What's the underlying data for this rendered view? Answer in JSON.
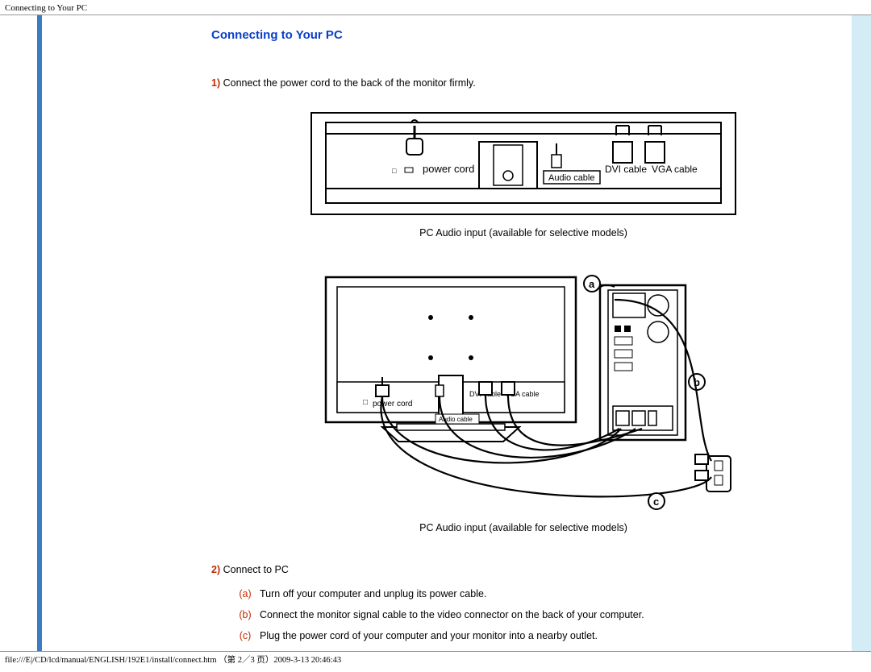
{
  "header_title": "Connecting to Your PC",
  "section_title": "Connecting to Your PC",
  "step1_num": "1)",
  "step1_text": " Connect the power cord to the back of the monitor firmly.",
  "caption1": "PC Audio input (available for selective models)",
  "caption2": "PC Audio input (available for selective models)",
  "step2_num": "2)",
  "step2_text": " Connect to PC",
  "sub_a_label": "(a)",
  "sub_a_text": "Turn off your computer and unplug its power cable.",
  "sub_b_label": "(b)",
  "sub_b_text": "Connect the monitor signal cable to the video connector on the back of your computer.",
  "sub_c_label": "(c)",
  "sub_c_text": "Plug the power cord of your computer and your monitor into a nearby outlet.",
  "diagram1": {
    "power_cord": "power cord",
    "audio_cable": "Audio cable",
    "dvi_cable": "DVI cable",
    "vga_cable": "VGA cable"
  },
  "diagram2": {
    "power_cord": "power cord",
    "audio_cable": "Audio cable",
    "dvi_cable": "DVI cable",
    "vga_cable": "VGA cable",
    "a": "a",
    "b": "b",
    "c": "c"
  },
  "footer_path": "file:///E|/CD/lcd/manual/ENGLISH/192E1/install/connect.htm （第 2／3 页）2009-3-13 20:46:43"
}
